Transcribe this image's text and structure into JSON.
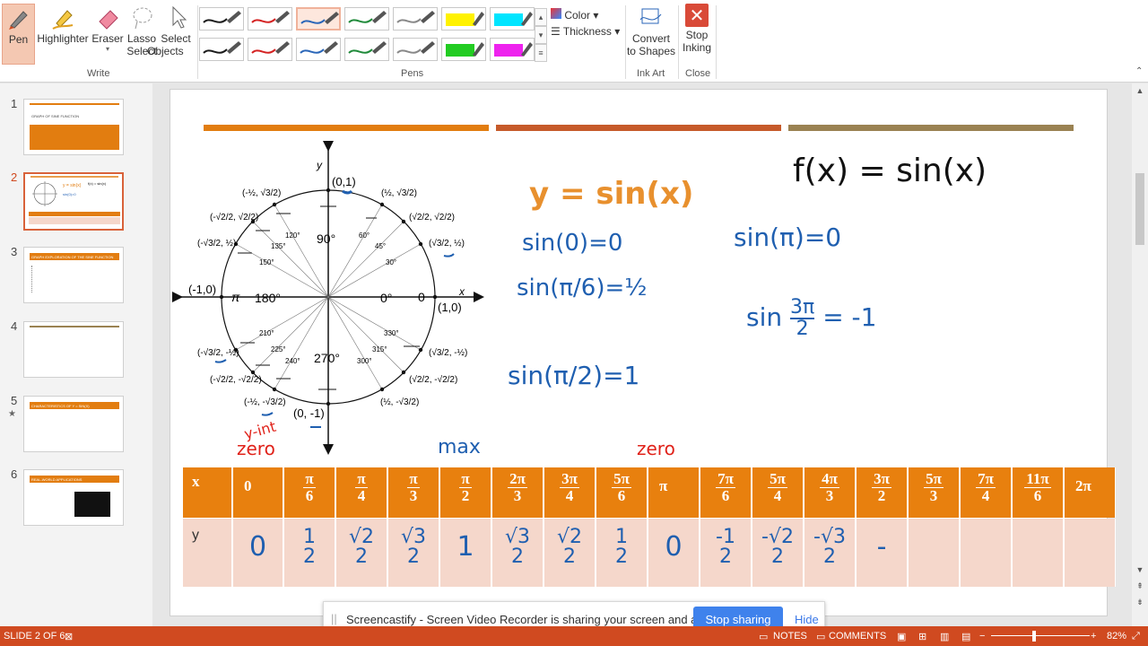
{
  "ribbon": {
    "write_group": {
      "label": "Write",
      "pen": "Pen",
      "highlighter": "Highlighter",
      "eraser": "Eraser",
      "lasso_line1": "Lasso",
      "lasso_line2": "Select",
      "select_line1": "Select",
      "select_line2": "Objects"
    },
    "pens_group": {
      "label": "Pens"
    },
    "format": {
      "color": "Color",
      "thickness": "Thickness"
    },
    "ink_art": {
      "line1": "Convert",
      "line2": "to Shapes",
      "label": "Ink Art"
    },
    "close": {
      "line1": "Stop",
      "line2": "Inking",
      "label": "Close"
    }
  },
  "pens": {
    "row1": [
      "#1a1a1a",
      "#d42222",
      "#2a66b8",
      "#1f8a3a",
      "#888888",
      "#fff200",
      "#00e5ff"
    ],
    "row2": [
      "#1a1a1a",
      "#d42222",
      "#2a66b8",
      "#1f8a3a",
      "#888888",
      "#22cc22",
      "#ee22ee"
    ],
    "selected": "row1-3"
  },
  "thumbnails": {
    "numbers": [
      "1",
      "2",
      "3",
      "4",
      "5",
      "6"
    ],
    "t1_title": "GRAPH OF SINE FUNCTION",
    "t3_title": "GRAPH EXPLORATION OF THE SINE FUNCTION",
    "t5_title": "CHARACTERISTICS OF Y = SIN(X)",
    "t6_title": "REAL-WORLD APPLICATIONS"
  },
  "slide": {
    "bar_colors": [
      "#e27d10",
      "#c65a2a",
      "#9a8252"
    ],
    "unit_circle": {
      "y_axis": "y",
      "x_axis": "x",
      "top_point": "(0,1)",
      "left_point": "(-1,0)",
      "right_point": "(1,0)",
      "bottom_point": "(0, -1)",
      "angle_90": "90°",
      "angle_180": "180°",
      "angle_0": "0°",
      "angle_270": "270°",
      "pi_label": "π",
      "zero_label": "0",
      "deg_120": "120°",
      "deg_135": "135°",
      "deg_150": "150°",
      "deg_60": "60°",
      "deg_45": "45°",
      "deg_30": "30°",
      "deg_210": "210°",
      "deg_225": "225°",
      "deg_240": "240°",
      "deg_300": "300°",
      "deg_315": "315°",
      "deg_330": "330°",
      "coord_q2_a": "(-½, √3/2)",
      "coord_q2_b": "(-√2/2, √2/2)",
      "coord_q2_c": "(-√3/2, ½)",
      "coord_q1_a": "(½, √3/2)",
      "coord_q1_b": "(√2/2, √2/2)",
      "coord_q1_c": "(√3/2, ½)",
      "coord_q3_a": "(-√3/2, -½)",
      "coord_q3_b": "(-√2/2, -√2/2)",
      "coord_q3_c": "(-½, -√3/2)",
      "coord_q4_a": "(√3/2, -½)",
      "coord_q4_b": "(√2/2, -√2/2)",
      "coord_q4_c": "(½, -√3/2)"
    },
    "orange_title": "y = sin(x)",
    "ink": {
      "fx": "f(x) = sin(x)",
      "sin0": "sin(0)=0",
      "sinpi6": "sin(π/6)=½",
      "sinpi2": "sin(π/2)=1",
      "sinpi": "sin(π)=0",
      "sin3pi2_pre": "sin",
      "sin3pi2_num": "3π",
      "sin3pi2_den": "2",
      "sin3pi2_post": "= -1",
      "yint": "y-int",
      "zero1": "zero",
      "max": "max",
      "zero2": "zero"
    },
    "table": {
      "x_label": "x",
      "y_label": "y",
      "x_values": [
        {
          "num": "0",
          "den": ""
        },
        {
          "num": "π",
          "den": "6"
        },
        {
          "num": "π",
          "den": "4"
        },
        {
          "num": "π",
          "den": "3"
        },
        {
          "num": "π",
          "den": "2"
        },
        {
          "num": "2π",
          "den": "3"
        },
        {
          "num": "3π",
          "den": "4"
        },
        {
          "num": "5π",
          "den": "6"
        },
        {
          "num": "π",
          "den": ""
        },
        {
          "num": "7π",
          "den": "6"
        },
        {
          "num": "5π",
          "den": "4"
        },
        {
          "num": "4π",
          "den": "3"
        },
        {
          "num": "3π",
          "den": "2"
        },
        {
          "num": "5π",
          "den": "3"
        },
        {
          "num": "7π",
          "den": "4"
        },
        {
          "num": "11π",
          "den": "6"
        },
        {
          "num": "2π",
          "den": ""
        }
      ],
      "y_values": [
        {
          "num": "0",
          "den": ""
        },
        {
          "num": "1",
          "den": "2"
        },
        {
          "num": "√2",
          "den": "2"
        },
        {
          "num": "√3",
          "den": "2"
        },
        {
          "num": "1",
          "den": ""
        },
        {
          "num": "√3",
          "den": "2"
        },
        {
          "num": "√2",
          "den": "2"
        },
        {
          "num": "1",
          "den": "2"
        },
        {
          "num": "0",
          "den": ""
        },
        {
          "num": "-1",
          "den": "2"
        },
        {
          "num": "-√2",
          "den": "2"
        },
        {
          "num": "-√3",
          "den": "2"
        },
        {
          "num": "-",
          "den": ""
        },
        {
          "num": "",
          "den": ""
        },
        {
          "num": "",
          "den": ""
        },
        {
          "num": "",
          "den": ""
        },
        {
          "num": "",
          "den": ""
        }
      ]
    }
  },
  "screencastify": {
    "message": "Screencastify - Screen Video Recorder is sharing your screen and audio.",
    "stop": "Stop sharing",
    "hide": "Hide"
  },
  "status": {
    "slide": "SLIDE 2 OF 6",
    "notes": "NOTES",
    "comments": "COMMENTS",
    "zoom": "82%"
  }
}
